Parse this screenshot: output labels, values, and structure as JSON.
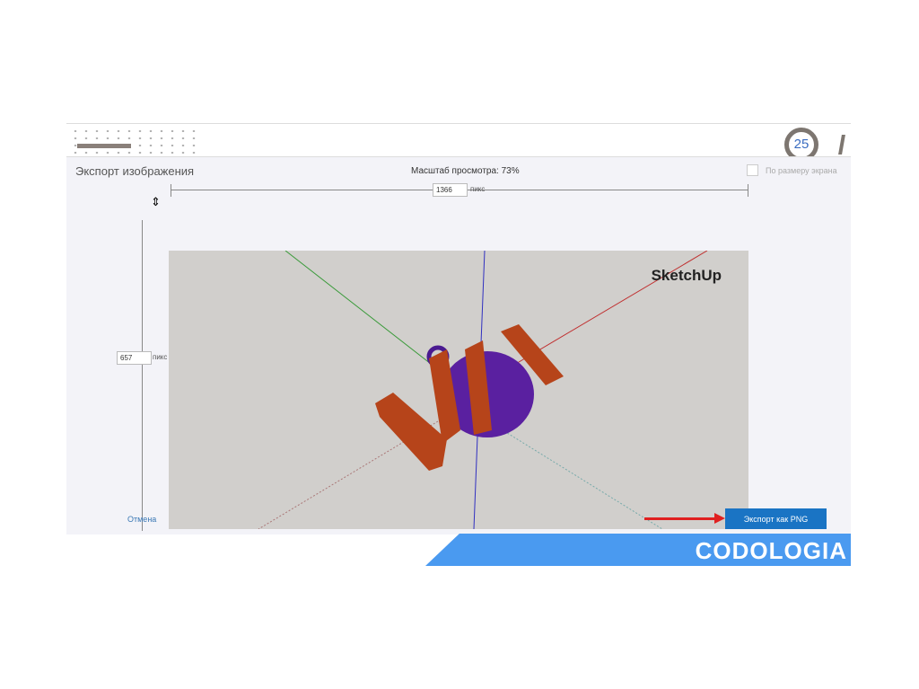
{
  "slide_number": "25",
  "dialog": {
    "title": "Экспорт изображения",
    "scale_label": "Масштаб просмотра: 73%",
    "fit_label": "По размеру экрана",
    "width_value": "1366",
    "height_value": "657",
    "unit": "пикс",
    "cancel_label": "Отмена",
    "export_label": "Экспорт как PNG"
  },
  "viewport": {
    "brand": "SketchUp"
  },
  "footer": {
    "logo": "CODOLOGIA"
  }
}
